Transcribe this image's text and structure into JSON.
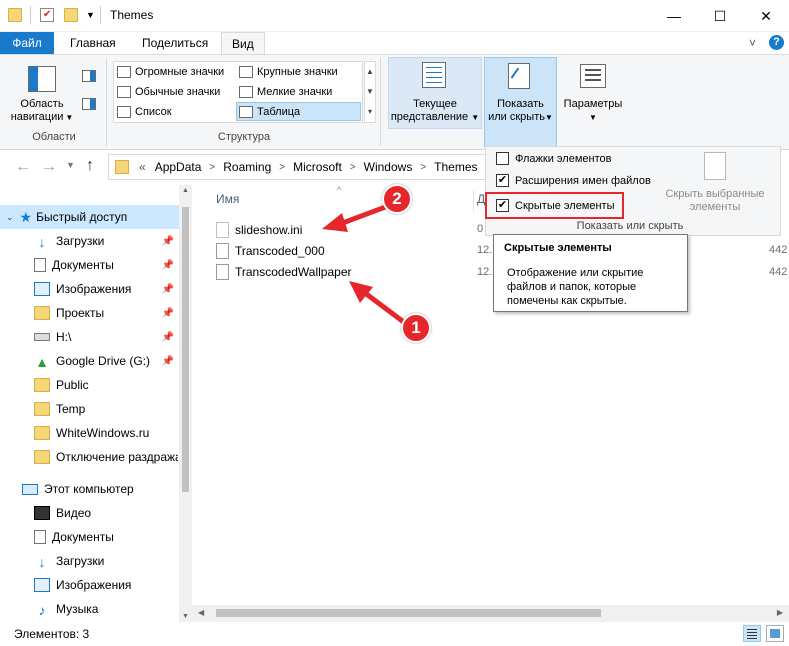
{
  "window": {
    "title": "Themes",
    "controls": {
      "minimize": "—",
      "maximize": "☐",
      "close": "✕"
    }
  },
  "ribbon": {
    "tabs": [
      "Файл",
      "Главная",
      "Поделиться",
      "Вид"
    ],
    "help_glyph": "?",
    "collapse_glyph": "˅",
    "panes": {
      "nav_label_1": "Область",
      "nav_label_2": "навигации",
      "group": "Области"
    },
    "layout": {
      "items": [
        "Огромные значки",
        "Крупные значки",
        "Обычные значки",
        "Мелкие значки",
        "Список",
        "Таблица"
      ],
      "selected": "Таблица",
      "group": "Структура"
    },
    "current_view": {
      "line1": "Текущее",
      "line2": "представление"
    },
    "show_hide": {
      "line1": "Показать",
      "line2": "или скрыть"
    },
    "options": {
      "label": "Параметры"
    }
  },
  "show_hide_panel": {
    "checkboxes": [
      {
        "label": "Флажки элементов",
        "checked": false
      },
      {
        "label": "Расширения имен файлов",
        "checked": true
      },
      {
        "label": "Скрытые элементы",
        "checked": true
      }
    ],
    "hide_selected_1": "Скрыть выбранные",
    "hide_selected_2": "элементы",
    "group": "Показать или скрыть"
  },
  "address": {
    "overflow": "«",
    "crumbs": [
      "AppData",
      "Roaming",
      "Microsoft",
      "Windows",
      "Themes"
    ]
  },
  "navigation": {
    "quick_access": "Быстрый доступ",
    "quick_items": [
      "Загрузки",
      "Документы",
      "Изображения",
      "Проекты",
      "H:\\",
      "Google Drive (G:)",
      "Public",
      "Temp",
      "WhiteWindows.ru",
      "Отключение раздража"
    ],
    "this_pc": "Этот компьютер",
    "pc_items": [
      "Видео",
      "Документы",
      "Загрузки",
      "Изображения",
      "Музыка"
    ]
  },
  "file_list": {
    "header_name": "Имя",
    "header_date": "Д",
    "files": [
      {
        "name": "slideshow.ini",
        "date": "0",
        "size": ""
      },
      {
        "name": "Transcoded_000",
        "date": "12.",
        "size": "442"
      },
      {
        "name": "TranscodedWallpaper",
        "date": "12.",
        "size": "442"
      }
    ],
    "size_first": "44"
  },
  "tooltip": {
    "title": "Скрытые элементы",
    "body": "Отображение или скрытие файлов и папок, которые помечены как скрытые."
  },
  "status": {
    "count": "Элементов: 3"
  },
  "annotations": {
    "badge1": "1",
    "badge2": "2"
  },
  "colors": {
    "accent": "#1979ca",
    "highlight": "#e5262b",
    "selection": "#cce4f7"
  }
}
